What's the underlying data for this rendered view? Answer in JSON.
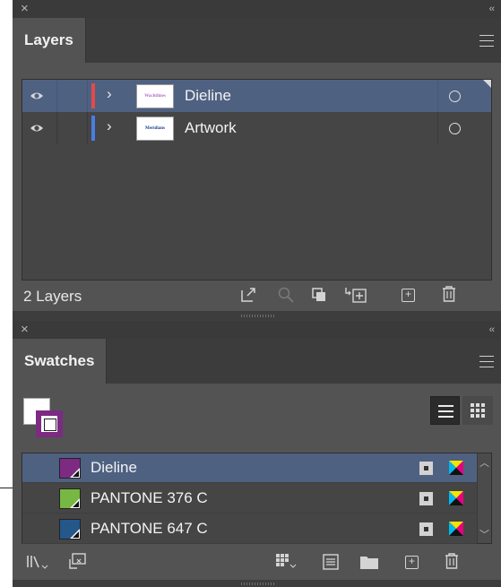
{
  "layers_panel": {
    "close_icon": "×",
    "collapse_icon": "‹‹",
    "tab_label": "Layers",
    "layers": [
      {
        "name": "Dieline",
        "thumb_text": "Wachtlines",
        "color": "#e34a4a",
        "selected": true
      },
      {
        "name": "Artwork",
        "thumb_text": "Meridians",
        "color": "#4a7de3",
        "selected": false
      }
    ],
    "footer_count": "2 Layers",
    "footer_icons": [
      "export-icon",
      "locate-object-icon",
      "make-clipping-mask-icon",
      "new-sublayer-icon",
      "new-layer-icon",
      "trash-icon"
    ]
  },
  "swatches_panel": {
    "close_icon": "×",
    "collapse_icon": "‹‹",
    "tab_label": "Swatches",
    "fill_color": "#ffffff",
    "stroke_color": "#7d2a82",
    "swatches": [
      {
        "name": "Dieline",
        "color": "#7d2a82",
        "selected": true
      },
      {
        "name": "PANTONE 376 C",
        "color": "#76b843",
        "selected": false
      },
      {
        "name": "PANTONE 647 C",
        "color": "#24578a",
        "selected": false
      }
    ],
    "footer_icons": [
      "swatch-library-icon",
      "place-swatches-icon",
      "show-swatch-kinds-icon",
      "swatch-options-icon",
      "new-color-group-icon",
      "new-swatch-icon",
      "trash-icon"
    ]
  },
  "colors": {
    "panel_bg": "#535353",
    "selection": "#4f6181"
  }
}
